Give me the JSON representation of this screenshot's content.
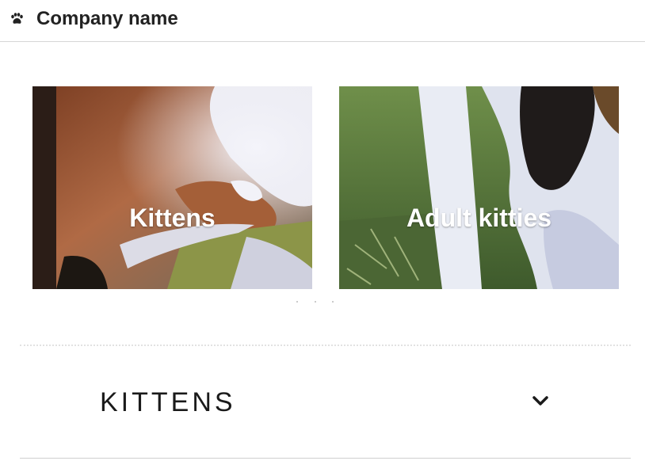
{
  "header": {
    "logo_icon": "paw-icon",
    "company_name": "Company name"
  },
  "tiles": [
    {
      "label": "Kittens",
      "image": "kitten-photo"
    },
    {
      "label": "Adult kitties",
      "image": "adult-cat-photo"
    }
  ],
  "section": {
    "title": "KITTENS",
    "expand_icon": "chevron-down-icon"
  },
  "colors": {
    "text": "#222222",
    "divider": "#d6d6d6",
    "label": "#ffffff"
  }
}
